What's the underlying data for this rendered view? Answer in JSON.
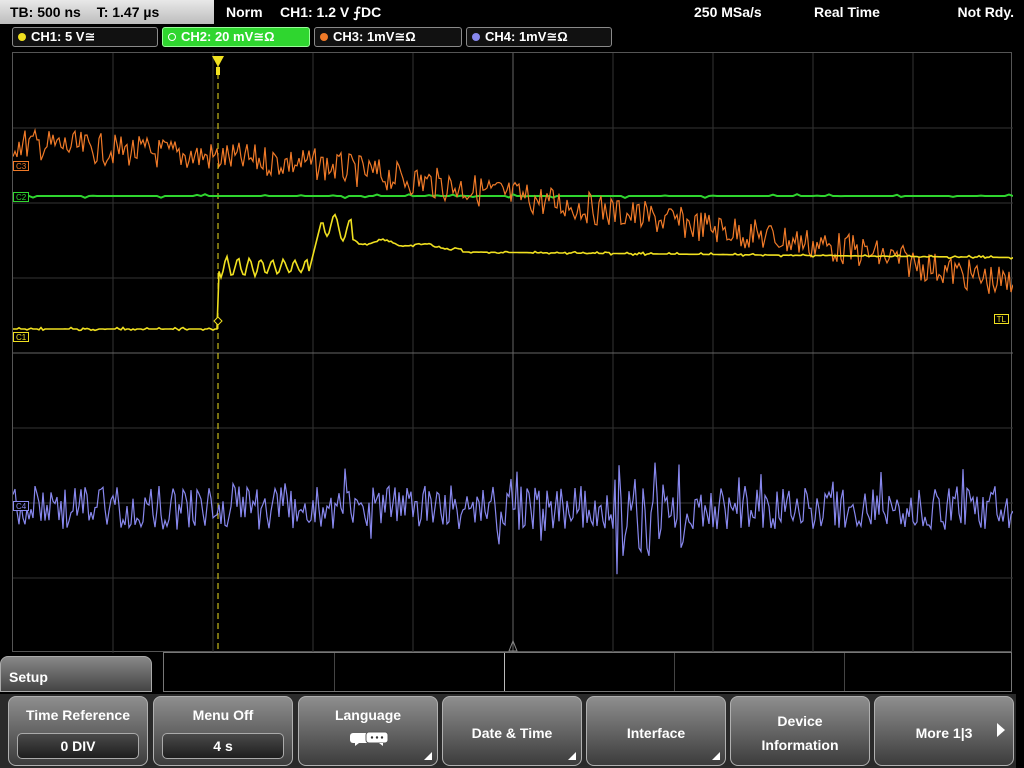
{
  "topbar": {
    "timebase": "TB: 500 ns",
    "trigger_time": "T: 1.47 µs",
    "mode": "Norm",
    "trigger": "CH1: 1.2 V ⨍DC",
    "sample_rate": "250 MSa/s",
    "acquisition": "Real Time",
    "status": "Not Rdy."
  },
  "channels": [
    {
      "label": "CH1: 5 V≅",
      "color": "#f0e020"
    },
    {
      "label": "CH2: 20 mV≅Ω",
      "color": "#2fd62f"
    },
    {
      "label": "CH3: 1mV≅Ω",
      "color": "#f07a28"
    },
    {
      "label": "CH4: 1mV≅Ω",
      "color": "#8888ee"
    }
  ],
  "markers": {
    "c3": "C3",
    "c2": "C2",
    "c1": "C1",
    "c4": "C4",
    "tl": "TL"
  },
  "menu": {
    "title": "Setup",
    "keys": {
      "time_reference": {
        "label": "Time Reference",
        "value": "0 DIV"
      },
      "menu_off": {
        "label": "Menu Off",
        "value": "4 s"
      },
      "language": {
        "label": "Language"
      },
      "date_time": {
        "label": "Date & Time"
      },
      "interface": {
        "label": "Interface"
      },
      "device_info": {
        "label1": "Device",
        "label2": "Information"
      },
      "more": {
        "label": "More 1|3"
      }
    }
  }
}
